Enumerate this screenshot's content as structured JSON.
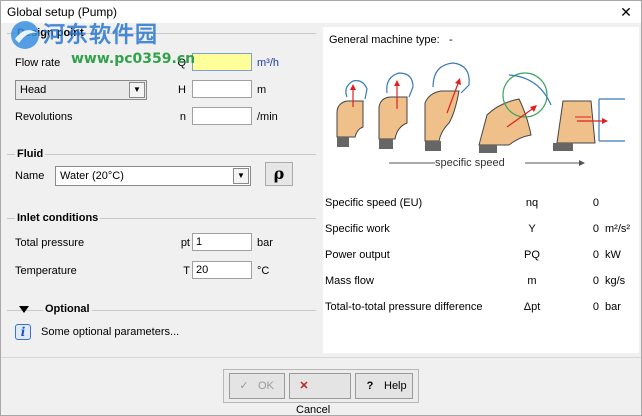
{
  "window": {
    "title": "Global setup (Pump)",
    "close": "✕"
  },
  "watermark": {
    "text1": "河东软件园",
    "text2": "www.pc0359.cn"
  },
  "design_point": {
    "title": "Design point",
    "flow_rate_label": "Flow rate",
    "flow_rate_symbol": "Q",
    "flow_rate_value": "",
    "flow_rate_unit": "m³/h",
    "head_select": "Head",
    "head_symbol": "H",
    "head_value": "",
    "head_unit": "m",
    "revolutions_label": "Revolutions",
    "revolutions_symbol": "n",
    "revolutions_value": "",
    "revolutions_unit": "/min"
  },
  "fluid": {
    "title": "Fluid",
    "name_label": "Name",
    "name_value": "Water (20°C)",
    "rho_button": "ρ"
  },
  "inlet": {
    "title": "Inlet conditions",
    "pressure_label": "Total pressure",
    "pressure_symbol": "pt",
    "pressure_value": "1",
    "pressure_unit": "bar",
    "temp_label": "Temperature",
    "temp_symbol": "T",
    "temp_value": "20",
    "temp_unit": "°C"
  },
  "optional": {
    "title": "Optional",
    "text": "Some optional parameters..."
  },
  "right": {
    "machine_type_label": "General machine type:",
    "machine_type_value": "-",
    "specific_speed_axis": "specific speed",
    "results": [
      {
        "label": "Specific speed (EU)",
        "symbol": "nq",
        "value": "0",
        "unit": ""
      },
      {
        "label": "Specific work",
        "symbol": "Y",
        "value": "0",
        "unit": "m²/s²"
      },
      {
        "label": "Power output",
        "symbol": "PQ",
        "value": "0",
        "unit": "kW"
      },
      {
        "label": "Mass flow",
        "symbol": "m",
        "value": "0",
        "unit": "kg/s"
      },
      {
        "label": "Total-to-total pressure difference",
        "symbol": "Δpt",
        "value": "0",
        "unit": "bar"
      }
    ]
  },
  "buttons": {
    "ok": "OK",
    "cancel": "Cancel",
    "help": "Help"
  },
  "colors": {
    "impeller": "#f0c08a",
    "arrow": "#e02020",
    "blade_outline": "#3a7ab8"
  }
}
